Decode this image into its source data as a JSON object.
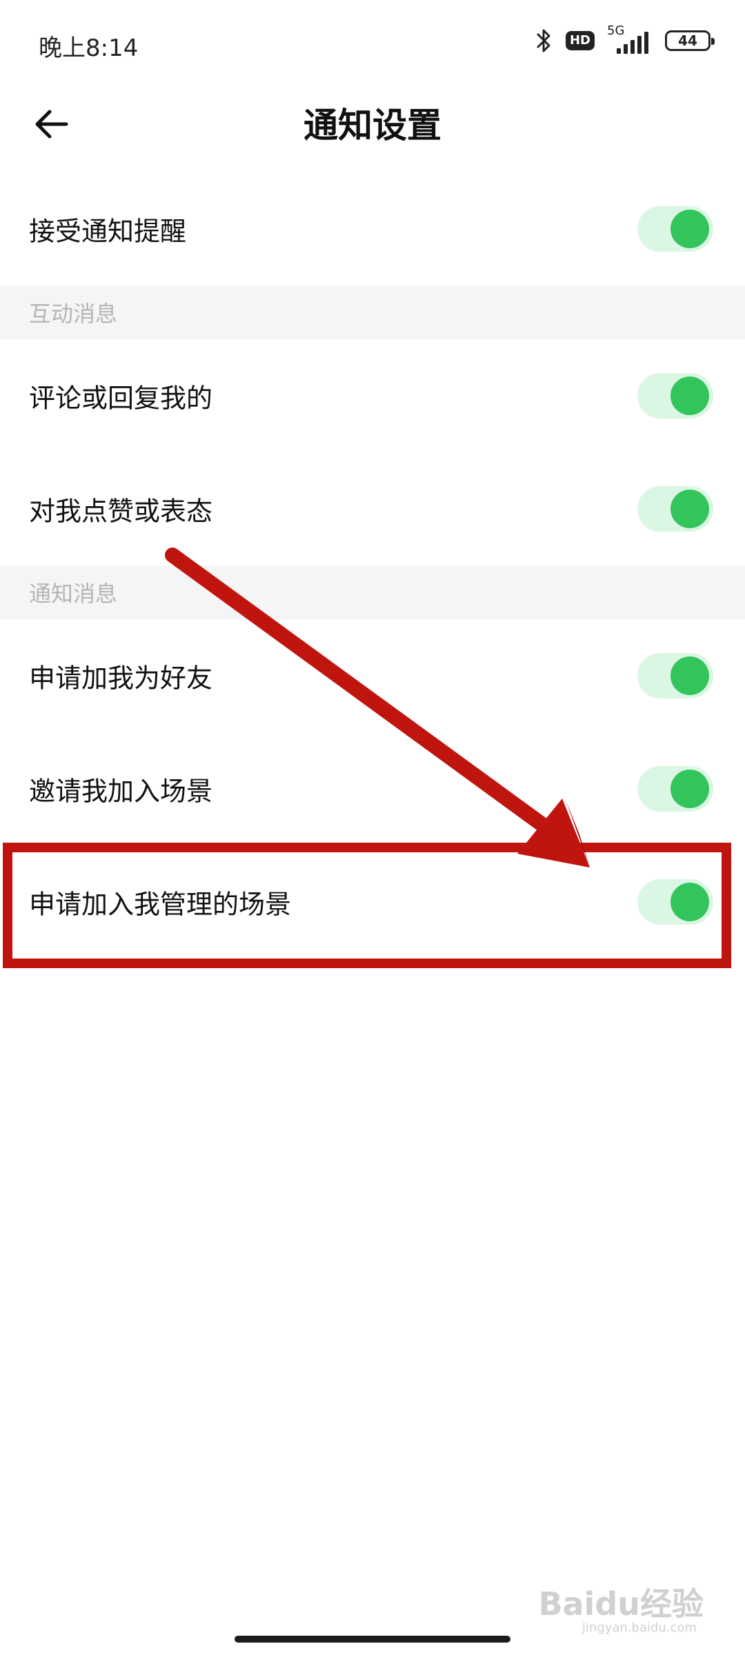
{
  "status_bar": {
    "time": "晚上8:14",
    "hd_label": "HD",
    "network_label": "5G",
    "battery_level": "44",
    "icons": [
      "bluetooth-icon",
      "hd-icon",
      "signal-icon",
      "battery-icon"
    ]
  },
  "header": {
    "title": "通知设置",
    "back_icon": "arrow-left-icon"
  },
  "rows": {
    "accept_notifications": {
      "label": "接受通知提醒",
      "enabled": true
    },
    "section_interaction": "互动消息",
    "comment_reply": {
      "label": "评论或回复我的",
      "enabled": true
    },
    "like_react": {
      "label": "对我点赞或表态",
      "enabled": true
    },
    "section_notification": "通知消息",
    "friend_request": {
      "label": "申请加我为好友",
      "enabled": true
    },
    "scene_invite": {
      "label": "邀请我加入场景",
      "enabled": true
    },
    "scene_join_request": {
      "label": "申请加入我管理的场景",
      "enabled": true
    }
  },
  "colors": {
    "toggle_on_track": "#dcf6e4",
    "toggle_on_knob": "#33c45b",
    "section_bg": "#f5f5f5",
    "annotation_red": "#c0150f"
  },
  "watermark": {
    "main": "Baidu经验",
    "sub": "jingyan.baidu.com"
  }
}
